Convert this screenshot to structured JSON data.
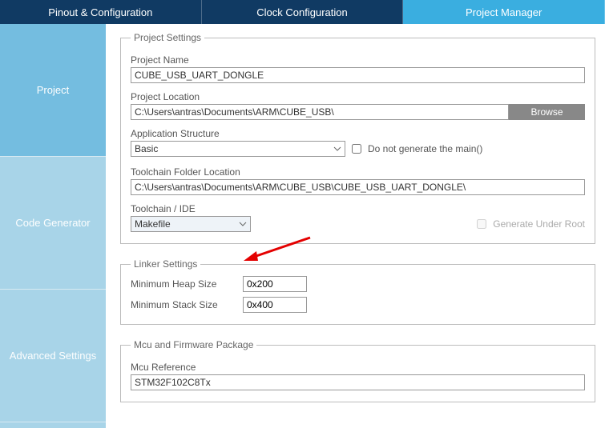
{
  "tabs": {
    "pinout": "Pinout & Configuration",
    "clock": "Clock Configuration",
    "pm": "Project Manager"
  },
  "sidebar": {
    "project": "Project",
    "codegen": "Code Generator",
    "advanced": "Advanced Settings"
  },
  "project_settings": {
    "legend": "Project Settings",
    "name_label": "Project Name",
    "name_value": "CUBE_USB_UART_DONGLE",
    "location_label": "Project Location",
    "location_value": "C:\\Users\\antras\\Documents\\ARM\\CUBE_USB\\",
    "browse": "Browse",
    "app_structure_label": "Application Structure",
    "app_structure_value": "Basic",
    "no_main_label": "Do not generate the main()",
    "toolchain_folder_label": "Toolchain Folder Location",
    "toolchain_folder_value": "C:\\Users\\antras\\Documents\\ARM\\CUBE_USB\\CUBE_USB_UART_DONGLE\\",
    "toolchain_ide_label": "Toolchain / IDE",
    "toolchain_ide_value": "Makefile",
    "gen_under_root_label": "Generate Under Root"
  },
  "linker": {
    "legend": "Linker Settings",
    "heap_label": "Minimum Heap Size",
    "heap_value": "0x200",
    "stack_label": "Minimum Stack Size",
    "stack_value": "0x400"
  },
  "mcu": {
    "legend": "Mcu and Firmware Package",
    "ref_label": "Mcu Reference",
    "ref_value": "STM32F102C8Tx"
  }
}
